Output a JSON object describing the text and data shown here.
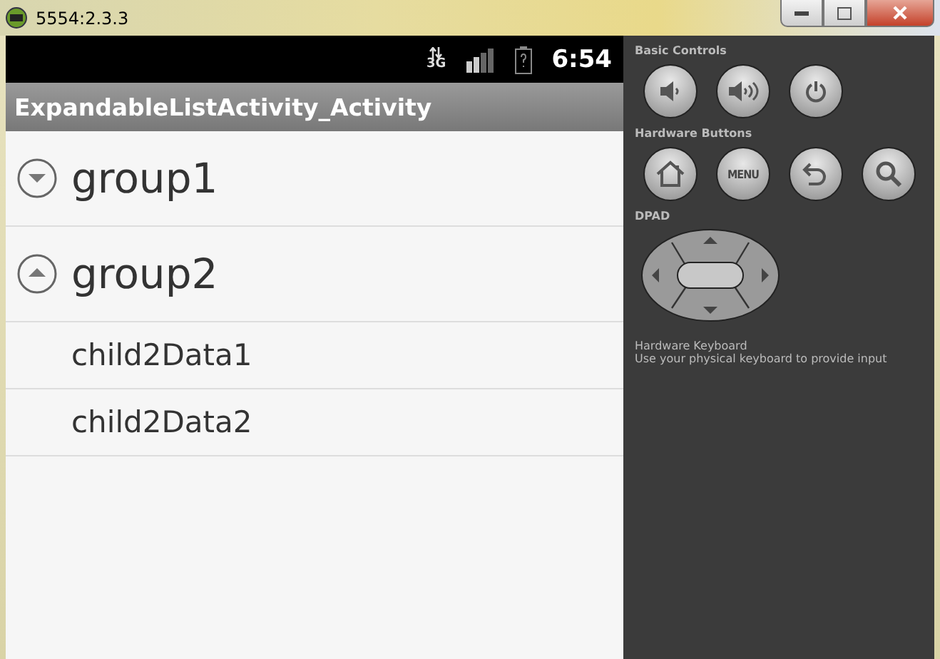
{
  "window": {
    "title": "5554:2.3.3"
  },
  "status_bar": {
    "network": "3G",
    "time": "6:54"
  },
  "app_bar": {
    "title": "ExpandableListActivity_Activity"
  },
  "list": [
    {
      "label": "group1",
      "expanded": false
    },
    {
      "label": "group2",
      "expanded": true,
      "children": [
        {
          "label": "child2Data1"
        },
        {
          "label": "child2Data2"
        }
      ]
    }
  ],
  "controls_panel": {
    "sections": [
      {
        "title": "Basic Controls",
        "kind": "buttons",
        "buttons": [
          {
            "kind": "volume-down"
          },
          {
            "kind": "volume-up"
          },
          {
            "kind": "power"
          }
        ]
      },
      {
        "title": "Hardware Buttons",
        "kind": "buttons",
        "buttons": [
          {
            "kind": "home"
          },
          {
            "kind": "menu",
            "label": "MENU"
          },
          {
            "kind": "back"
          },
          {
            "kind": "search"
          }
        ]
      },
      {
        "title": "DPAD",
        "kind": "dpad"
      }
    ],
    "keyboard": {
      "title": "Hardware Keyboard",
      "text": "Use your physical keyboard to provide input"
    }
  }
}
